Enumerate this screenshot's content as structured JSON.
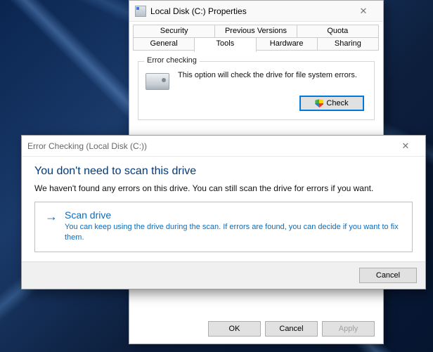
{
  "properties": {
    "title": "Local Disk (C:) Properties",
    "tabs_row1": [
      "Security",
      "Previous Versions",
      "Quota"
    ],
    "tabs_row2": [
      "General",
      "Tools",
      "Hardware",
      "Sharing"
    ],
    "active_tab": "Tools",
    "error_checking": {
      "legend": "Error checking",
      "description": "This option will check the drive for file system errors.",
      "check_button": "Check"
    },
    "buttons": {
      "ok": "OK",
      "cancel": "Cancel",
      "apply": "Apply"
    }
  },
  "dialog": {
    "title": "Error Checking (Local Disk (C:))",
    "headline": "You don't need to scan this drive",
    "subtext": "We haven't found any errors on this drive. You can still scan the drive for errors if you want.",
    "action": {
      "title": "Scan drive",
      "description": "You can keep using the drive during the scan. If errors are found, you can decide if you want to fix them."
    },
    "cancel": "Cancel"
  }
}
